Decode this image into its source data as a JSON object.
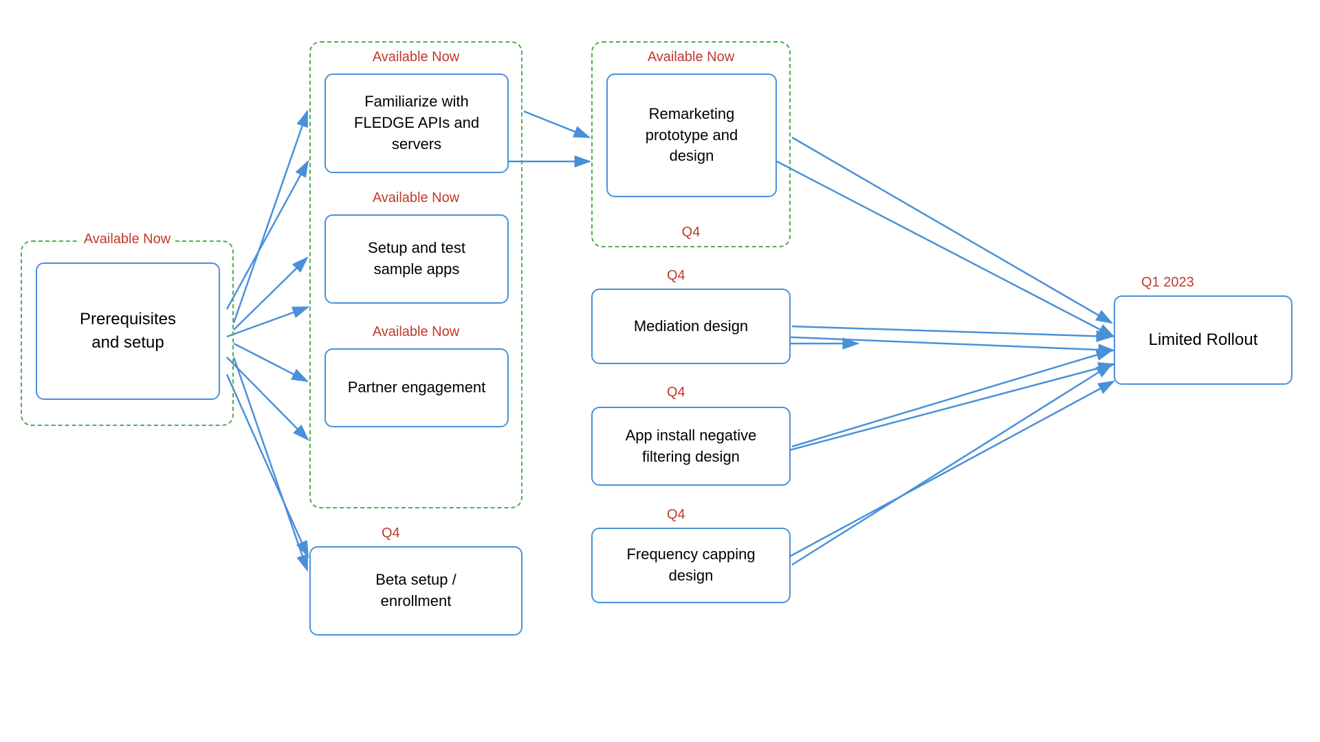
{
  "nodes": {
    "prerequisites": {
      "label": "Prerequisites\nand setup",
      "status": "Available Now"
    },
    "familiarize": {
      "label": "Familiarize with\nFLEDGE APIs and\nservers",
      "status": "Available Now"
    },
    "setup_test": {
      "label": "Setup and test\nsample apps",
      "status": "Available Now"
    },
    "partner": {
      "label": "Partner engagement",
      "status": "Available Now"
    },
    "beta": {
      "label": "Beta setup /\nenrollment",
      "status": "Q4"
    },
    "remarketing": {
      "label": "Remarketing\nprototype and\ndesign",
      "status": "Available Now"
    },
    "mediation": {
      "label": "Mediation design",
      "status": "Q4"
    },
    "app_install": {
      "label": "App install negative\nfiltering design",
      "status": "Q4"
    },
    "frequency": {
      "label": "Frequency capping\ndesign",
      "status": "Q4"
    },
    "limited_rollout": {
      "label": "Limited Rollout",
      "status": "Q1 2023"
    }
  },
  "labels": {
    "available_now": "Available Now",
    "q4": "Q4",
    "q1_2023": "Q1 2023"
  }
}
